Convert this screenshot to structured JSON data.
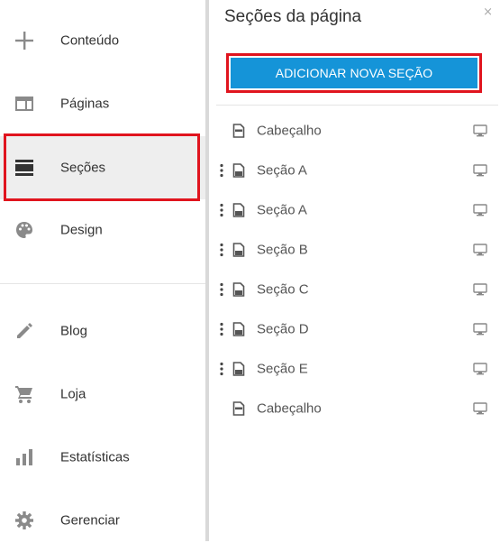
{
  "sidebar": {
    "items": [
      {
        "label": "Conteúdo",
        "icon": "plus-icon"
      },
      {
        "label": "Páginas",
        "icon": "page-layout-icon"
      },
      {
        "label": "Seções",
        "icon": "sections-icon",
        "active": true
      },
      {
        "label": "Design",
        "icon": "palette-icon"
      },
      {
        "label": "Blog",
        "icon": "pencil-icon"
      },
      {
        "label": "Loja",
        "icon": "cart-icon"
      },
      {
        "label": "Estatísticas",
        "icon": "bar-chart-icon"
      },
      {
        "label": "Gerenciar",
        "icon": "gear-icon"
      }
    ]
  },
  "panel": {
    "title": "Seções da página",
    "close": "×",
    "add_button": "ADICIONAR NOVA SEÇÃO",
    "sections": [
      {
        "name": "Cabeçalho",
        "draggable": false
      },
      {
        "name": "Seção A",
        "draggable": true
      },
      {
        "name": "Seção A",
        "draggable": true
      },
      {
        "name": "Seção B",
        "draggable": true
      },
      {
        "name": "Seção C",
        "draggable": true
      },
      {
        "name": "Seção D",
        "draggable": true
      },
      {
        "name": "Seção E",
        "draggable": true
      },
      {
        "name": "Cabeçalho",
        "draggable": false
      }
    ]
  },
  "colors": {
    "accent": "#1594d8",
    "highlight_outline": "#e0141e",
    "icon_gray": "#8a8a8a",
    "active_bg": "#eeeeee"
  }
}
